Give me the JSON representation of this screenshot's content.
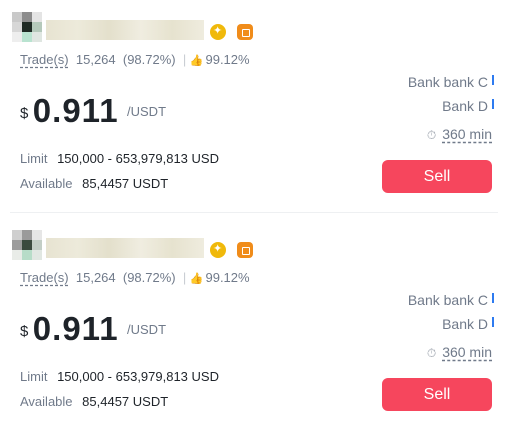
{
  "offers": [
    {
      "trades_label": "Trade(s)",
      "trades_count": "15,264",
      "completion": "(98.72%)",
      "positive_rate": "99.12%",
      "currency_symbol": "$",
      "price": "0.911",
      "price_unit": "/USDT",
      "limit_label": "Limit",
      "limit_value": "150,000 - 653,979,813 USD",
      "available_label": "Available",
      "available_value": "85,4457 USDT",
      "payment_methods": [
        "Bank bank C",
        "Bank D"
      ],
      "time_limit": "360 min",
      "action_label": "Sell",
      "icons": {
        "thumb": "thumbs-up-icon",
        "clock": "timer-icon",
        "verified": "verified-badge-icon",
        "merchant": "merchant-badge-icon"
      }
    },
    {
      "trades_label": "Trade(s)",
      "trades_count": "15,264",
      "completion": "(98.72%)",
      "positive_rate": "99.12%",
      "currency_symbol": "$",
      "price": "0.911",
      "price_unit": "/USDT",
      "limit_label": "Limit",
      "limit_value": "150,000 - 653,979,813 USD",
      "available_label": "Available",
      "available_value": "85,4457 USDT",
      "payment_methods": [
        "Bank bank C",
        "Bank D"
      ],
      "time_limit": "360 min",
      "action_label": "Sell",
      "icons": {
        "thumb": "thumbs-up-icon",
        "clock": "timer-icon",
        "verified": "verified-badge-icon",
        "merchant": "merchant-badge-icon"
      }
    }
  ],
  "colors": {
    "sell": "#f6465d",
    "text": "#1e2329",
    "muted": "#707a8a",
    "badge_gold": "#f0b90b",
    "badge_orange": "#f08c1a",
    "payment_bar": "#2e7bf0"
  }
}
